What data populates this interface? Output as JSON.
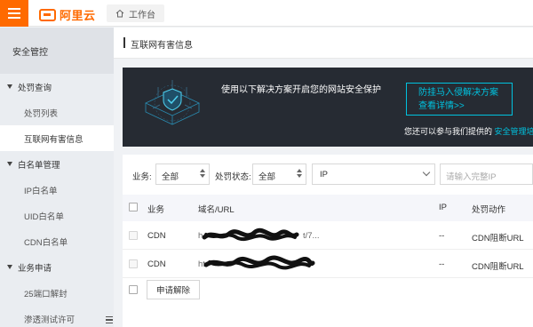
{
  "topbar": {
    "logo_text": "阿里云",
    "workspace_tab": "工作台",
    "brand_color": "#ff6a00"
  },
  "sidebar": {
    "heading": "安全管控",
    "groups": [
      {
        "label": "处罚查询",
        "items": [
          {
            "label": "处罚列表"
          },
          {
            "label": "互联网有害信息",
            "active": true
          }
        ]
      },
      {
        "label": "白名单管理",
        "items": [
          {
            "label": "IP白名单"
          },
          {
            "label": "UID白名单"
          },
          {
            "label": "CDN白名单"
          }
        ]
      },
      {
        "label": "业务申请",
        "items": [
          {
            "label": "25端口解封"
          },
          {
            "label": "渗透测试许可"
          }
        ]
      }
    ]
  },
  "page": {
    "title": "互联网有害信息"
  },
  "banner": {
    "text": "使用以下解决方案开启您的网站安全保护",
    "button_line1": "防挂马入侵解决方案",
    "button_line2": "查看详情>>",
    "sub_text": "您还可以参与我们提供的",
    "sub_link": "安全管理培训",
    "accent_color": "#00c1de"
  },
  "filters": {
    "business_label": "业务:",
    "business_value": "全部",
    "status_label": "处罚状态:",
    "status_value": "全部",
    "type_value": "IP",
    "search_placeholder": "请输入完整IP"
  },
  "table": {
    "headers": {
      "business": "业务",
      "domain": "域名/URL",
      "ip": "IP",
      "action": "处罚动作"
    },
    "rows": [
      {
        "business": "CDN",
        "url_prefix": "h",
        "url_suffix": "t/7...",
        "ip": "--",
        "action": "CDN阻断URL"
      },
      {
        "business": "CDN",
        "url_prefix": "ht",
        "url_suffix": "",
        "ip": "--",
        "action": "CDN阻断URL"
      }
    ],
    "unblock_button": "申请解除"
  }
}
